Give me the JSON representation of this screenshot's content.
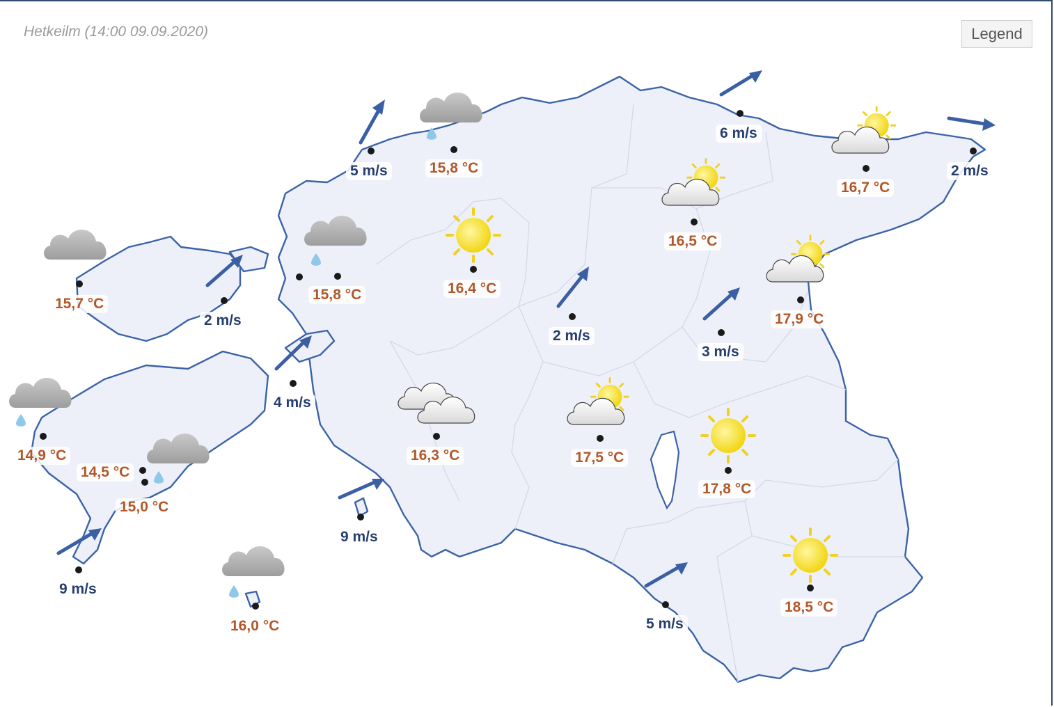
{
  "header": {
    "title": "Hetkeilm (14:00 09.09.2020)",
    "legend_label": "Legend"
  },
  "colors": {
    "land": "#eef0f9",
    "coast": "#3a63a8",
    "temperature_text": "#b0582a",
    "wind_text": "#263e6e",
    "wind_arrow": "#3a5fa3"
  },
  "stations": {
    "temps": [
      {
        "label": "15,8 °C",
        "icon": "cloud-rain-icon"
      },
      {
        "label": "16,7 °C",
        "icon": "sun-cloud-icon"
      },
      {
        "label": "16,5 °C",
        "icon": "sun-cloud-icon"
      },
      {
        "label": "15,7 °C",
        "icon": "cloud-icon"
      },
      {
        "label": "15,8 °C",
        "icon": "cloud-rain-icon"
      },
      {
        "label": "16,4 °C",
        "icon": "sun-icon"
      },
      {
        "label": "17,9 °C",
        "icon": "sun-cloud-icon"
      },
      {
        "label": "14,9 °C",
        "icon": "cloud-rain-icon"
      },
      {
        "label": "14,5 °C",
        "icon": "cloud-rain-icon"
      },
      {
        "label": "15,0 °C",
        "icon": "none"
      },
      {
        "label": "16,3 °C",
        "icon": "clouds-icon"
      },
      {
        "label": "17,5 °C",
        "icon": "sun-cloud-icon"
      },
      {
        "label": "17,8 °C",
        "icon": "sun-icon"
      },
      {
        "label": "16,0 °C",
        "icon": "cloud-rain-icon"
      },
      {
        "label": "18,5 °C",
        "icon": "sun-icon"
      }
    ],
    "winds": [
      {
        "label": "5 m/s",
        "direction": "wind-arrow-northeast"
      },
      {
        "label": "6 m/s",
        "direction": "wind-arrow-northeast"
      },
      {
        "label": "2 m/s",
        "direction": "wind-arrow-east"
      },
      {
        "label": "2 m/s",
        "direction": "wind-arrow-northeast"
      },
      {
        "label": "2 m/s",
        "direction": "wind-arrow-northeast"
      },
      {
        "label": "3 m/s",
        "direction": "wind-arrow-northeast"
      },
      {
        "label": "4 m/s",
        "direction": "wind-arrow-northeast"
      },
      {
        "label": "9 m/s",
        "direction": "wind-arrow-northeast"
      },
      {
        "label": "9 m/s",
        "direction": "wind-arrow-northeast"
      },
      {
        "label": "5 m/s",
        "direction": "wind-arrow-northeast"
      }
    ]
  }
}
